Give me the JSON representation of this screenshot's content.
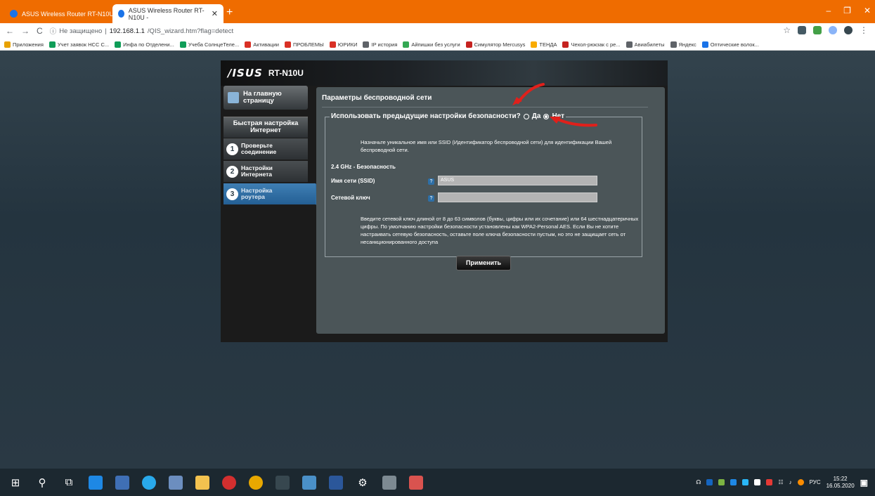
{
  "browser": {
    "tabs": [
      {
        "label": "ASUS Wireless Router RT-N10U",
        "active": false
      },
      {
        "label": "ASUS Wireless Router RT-N10U -",
        "active": true
      }
    ],
    "new_tab": "+",
    "window_controls": [
      "–",
      "❐",
      "✕"
    ],
    "nav": {
      "back": "←",
      "forward": "→",
      "reload": "C"
    },
    "address": {
      "security": "Не защищено",
      "separator": "|",
      "host": "192.168.1.1",
      "path": "/QIS_wizard.htm?flag=detect"
    },
    "bookmarks": [
      {
        "label": "Приложения",
        "color": "#e8a200"
      },
      {
        "label": "Учет заявок НСС С...",
        "color": "#0f9d58"
      },
      {
        "label": "Инфа по Отделени...",
        "color": "#0f9d58"
      },
      {
        "label": "Учеба СолнцеТеле...",
        "color": "#0f9d58"
      },
      {
        "label": "Активации",
        "color": "#d93025"
      },
      {
        "label": "ПРОБЛЕМЫ",
        "color": "#d93025"
      },
      {
        "label": "ЮРИКИ",
        "color": "#d93025"
      },
      {
        "label": "IP история",
        "color": "#5f6368"
      },
      {
        "label": "Айпишки без услуги",
        "color": "#34a853"
      },
      {
        "label": "Симулятор Mercusys",
        "color": "#c5221f"
      },
      {
        "label": "ТЕНДА",
        "color": "#f9ab00"
      },
      {
        "label": "Чехол-рюкзак с ре...",
        "color": "#c5221f"
      },
      {
        "label": "Авиабилеты",
        "color": "#5f6368"
      },
      {
        "label": "Яндекс",
        "color": "#5f6368"
      },
      {
        "label": "Оптические волок...",
        "color": "#1a73e8"
      }
    ]
  },
  "router": {
    "brand": "/ISUS",
    "model": "RT-N10U",
    "sidebar": {
      "home": "На главную страницу",
      "qis_header": "Быстрая настройка Интернет",
      "steps": [
        {
          "num": "1",
          "label": "Проверьте соединение",
          "active": false
        },
        {
          "num": "2",
          "label": "Настройки Интернета",
          "active": false
        },
        {
          "num": "3",
          "label": "Настройка роутера",
          "active": true
        }
      ]
    },
    "content": {
      "title": "Параметры беспроводной сети",
      "legend_question": "Использовать предыдущие настройки безопасности?",
      "options": [
        {
          "label": "Да",
          "checked": false
        },
        {
          "label": "Нет",
          "checked": true
        }
      ],
      "description": "Назначьте уникальное имя или SSID (Идентификатор беспроводной сети) для идентификации Вашей беспроводной сети.",
      "band_title": "2.4 GHz - Безопасность",
      "ssid_label": "Имя сети (SSID)",
      "ssid_value": "ASUS",
      "key_label": "Сетевой ключ",
      "key_value": "",
      "help": "?",
      "note": "Введите сетевой ключ длиной от 8 до 63 символов (буквы, цифры или их сочетание) или 64 шестнадцатеричных цифры. По умолчанию настройки безопасности установлены как WPA2-Personal AES. Если Вы не хотите настраивать сетевую безопасность, оставьте поле ключа безопасности пустым, но это не защищает сеть от несанкционированного доступа",
      "apply": "Применить"
    }
  },
  "taskbar": {
    "language": "РУС",
    "time": "15:22",
    "date": "16.05.2020"
  },
  "colors": {
    "chrome_orange": "#ef6c00",
    "annotation_red": "#e0201b",
    "active_step": "#2e6fa6"
  }
}
